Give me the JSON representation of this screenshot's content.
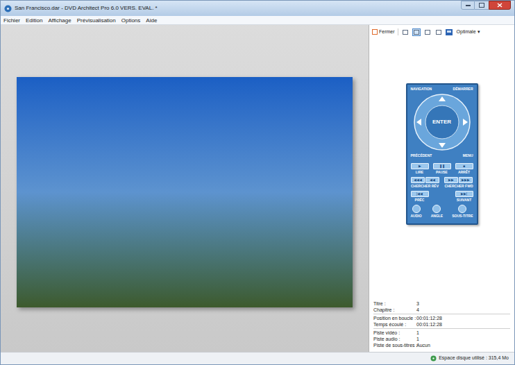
{
  "window": {
    "title": "San Francisco.dar - DVD Architect Pro 6.0 VERS. EVAL. *"
  },
  "menu": [
    "Fichier",
    "Edition",
    "Affichage",
    "Prévisualisation",
    "Options",
    "Aide"
  ],
  "toolbar": {
    "close": "Fermer",
    "views": [
      {
        "selected": false
      },
      {
        "selected": true
      },
      {
        "selected": false
      },
      {
        "selected": false
      }
    ],
    "zoom": "Optimale",
    "zoom_arrow": "▾"
  },
  "remote": {
    "top_left": "NAVIGATION",
    "top_right": "DÉMARRER",
    "bottom_left": "PRÉCÉDENT",
    "bottom_right": "MENU",
    "enter": "ENTER",
    "transport": [
      {
        "symbol": "▶",
        "label": "LIRE"
      },
      {
        "symbol": "❚❚",
        "label": "PAUSE"
      },
      {
        "symbol": "■",
        "label": "ARRÊT"
      }
    ],
    "search": [
      {
        "symbols": [
          "◀◀◀",
          "◀◀"
        ],
        "label": "CHERCHER RÉV"
      },
      {
        "symbols": [
          "▶▶",
          "▶▶▶"
        ],
        "label": "CHERCHER FWD"
      }
    ],
    "skip": [
      {
        "symbol": "|◀◀",
        "label": "PRÉC"
      },
      {
        "symbol": "▶▶|",
        "label": "SUIVANT"
      }
    ],
    "round": [
      {
        "label": "AUDIO"
      },
      {
        "label": "ANGLE"
      },
      {
        "label": "SOUS-TITRE"
      }
    ]
  },
  "info": [
    [
      {
        "label": "Titre :",
        "value": "3"
      },
      {
        "label": "Chapitre :",
        "value": "4"
      }
    ],
    [
      {
        "label": "Position en boucle :",
        "value": "00:01:12:28"
      },
      {
        "label": "Temps écoulé :",
        "value": "00:01:12:28"
      }
    ],
    [
      {
        "label": "Piste vidéo :",
        "value": "1"
      },
      {
        "label": "Piste audio :",
        "value": "1"
      },
      {
        "label": "Piste de sous-titres :",
        "value": "Aucun"
      }
    ]
  ],
  "status_bar": {
    "text": "Espace disque utilisé : 315,4 Mo"
  }
}
